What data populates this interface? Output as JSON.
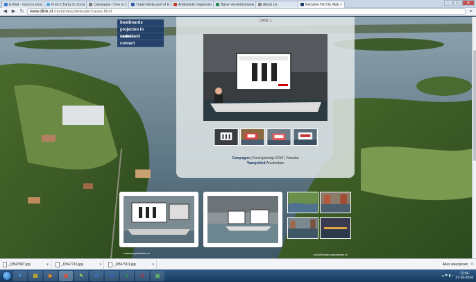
{
  "browser": {
    "tabs": [
      {
        "label": "E-Mail - mounce bongo",
        "color": "#3a7bd5"
      },
      {
        "label": "From Charity to Social E",
        "color": "#58a8e0"
      },
      {
        "label": "Campagne | Voor je Doe",
        "color": "#7a7a7a"
      },
      {
        "label": "Trade Media part of RTL",
        "color": "#2b5c9a"
      },
      {
        "label": "Ambulante Dagbesteding",
        "color": "#c0392b"
      },
      {
        "label": "Bijner-verstelbompoen",
        "color": "#2e8b57"
      },
      {
        "label": "About Us",
        "color": "#888888"
      },
      {
        "label": "Reclame Het Op Water",
        "color": "#1c3a66"
      }
    ],
    "active_tab": 7,
    "tab_close": "×",
    "window_controls": {
      "minimize": "–",
      "maximize": "□",
      "close": "✕"
    },
    "back_icon": "◀",
    "forward_icon": "▶",
    "reload_icon": "↻",
    "url_host": "www.dlink.nl",
    "url_path": "/reclameophetwater/cases.html",
    "menu_icon": "≡"
  },
  "site": {
    "nav": [
      "boatboards",
      "projecten in nederland",
      "cases",
      "contact"
    ],
    "case_title": "CASE 1",
    "case_info_label": "Campagne",
    "case_info_text": "| Koningimnetje 2010 | Yamaha",
    "case_info_label2": "Vaargebied",
    "case_info_text2": "Amsterdam",
    "credit_left": "reclameophetwater.nl",
    "credit_right": "info@reclameophetwater.nl",
    "colors": {
      "nav_bg": "#1c3a66",
      "accent": "#1f3a66"
    }
  },
  "downloads": {
    "items": [
      "_DB47897.jpg",
      "_DB47716.jpg",
      "_DB47901.jpg"
    ],
    "arrow": "▾",
    "show_all": "Alles weergeven",
    "close": "×"
  },
  "taskbar": {
    "icons": [
      {
        "name": "ie-icon",
        "glyph": "e",
        "color": "#4aa3ff"
      },
      {
        "name": "explorer-icon",
        "glyph": "▤",
        "color": "#f1c40f"
      },
      {
        "name": "media-player-icon",
        "glyph": "▶",
        "color": "#ff8c1a"
      },
      {
        "name": "chrome-icon",
        "glyph": "◉",
        "color": "#e74c3c"
      },
      {
        "name": "paint-icon",
        "glyph": "✎",
        "color": "#9bd35a"
      },
      {
        "name": "outlook-icon",
        "glyph": "O",
        "color": "#3d7fd6"
      },
      {
        "name": "word-icon",
        "glyph": "W",
        "color": "#2b64c7"
      },
      {
        "name": "excel-icon",
        "glyph": "X",
        "color": "#2e9c4e"
      },
      {
        "name": "pdf-icon",
        "glyph": "A",
        "color": "#d9302b"
      },
      {
        "name": "photos-icon",
        "glyph": "▣",
        "color": "#5dbb63"
      }
    ],
    "time": "12:54",
    "date": "27-10-2016",
    "tray_icons": "▴ ⚑ ▮ ♪"
  }
}
